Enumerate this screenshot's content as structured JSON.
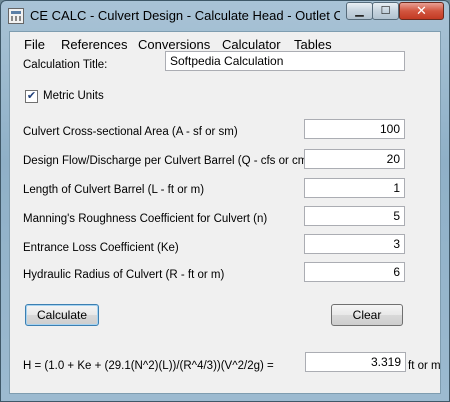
{
  "window": {
    "title": "CE CALC - Culvert Design - Calculate Head - Outlet Cont...",
    "minimize_glyph": "▁",
    "maximize_glyph": "☐",
    "close_glyph": "✕"
  },
  "menu": {
    "items": [
      "File",
      "References",
      "Conversions",
      "Calculator",
      "Tables"
    ]
  },
  "form": {
    "title_label": "Calculation Title:",
    "title_value": "Softpedia Calculation",
    "metric_label": "Metric Units",
    "metric_checked": true,
    "check_glyph": "✔",
    "fields": [
      {
        "label": "Culvert Cross-sectional Area (A - sf or sm)",
        "value": "100"
      },
      {
        "label": "Design Flow/Discharge per Culvert Barrel (Q - cfs or cms)",
        "value": "20"
      },
      {
        "label": "Length of Culvert Barrel (L - ft or m)",
        "value": "1"
      },
      {
        "label": "Manning's Roughness Coefficient for Culvert (n)",
        "value": "5"
      },
      {
        "label": "Entrance Loss Coefficient (Ke)",
        "value": "3"
      },
      {
        "label": "Hydraulic Radius of Culvert (R - ft or m)",
        "value": "6"
      }
    ],
    "calculate_label": "Calculate",
    "clear_label": "Clear",
    "formula_label": "H = (1.0 + Ke + (29.1(N^2)(L))/(R^4/3))(V^2/2g) =",
    "result_value": "3.319",
    "result_unit": "ft or m"
  }
}
